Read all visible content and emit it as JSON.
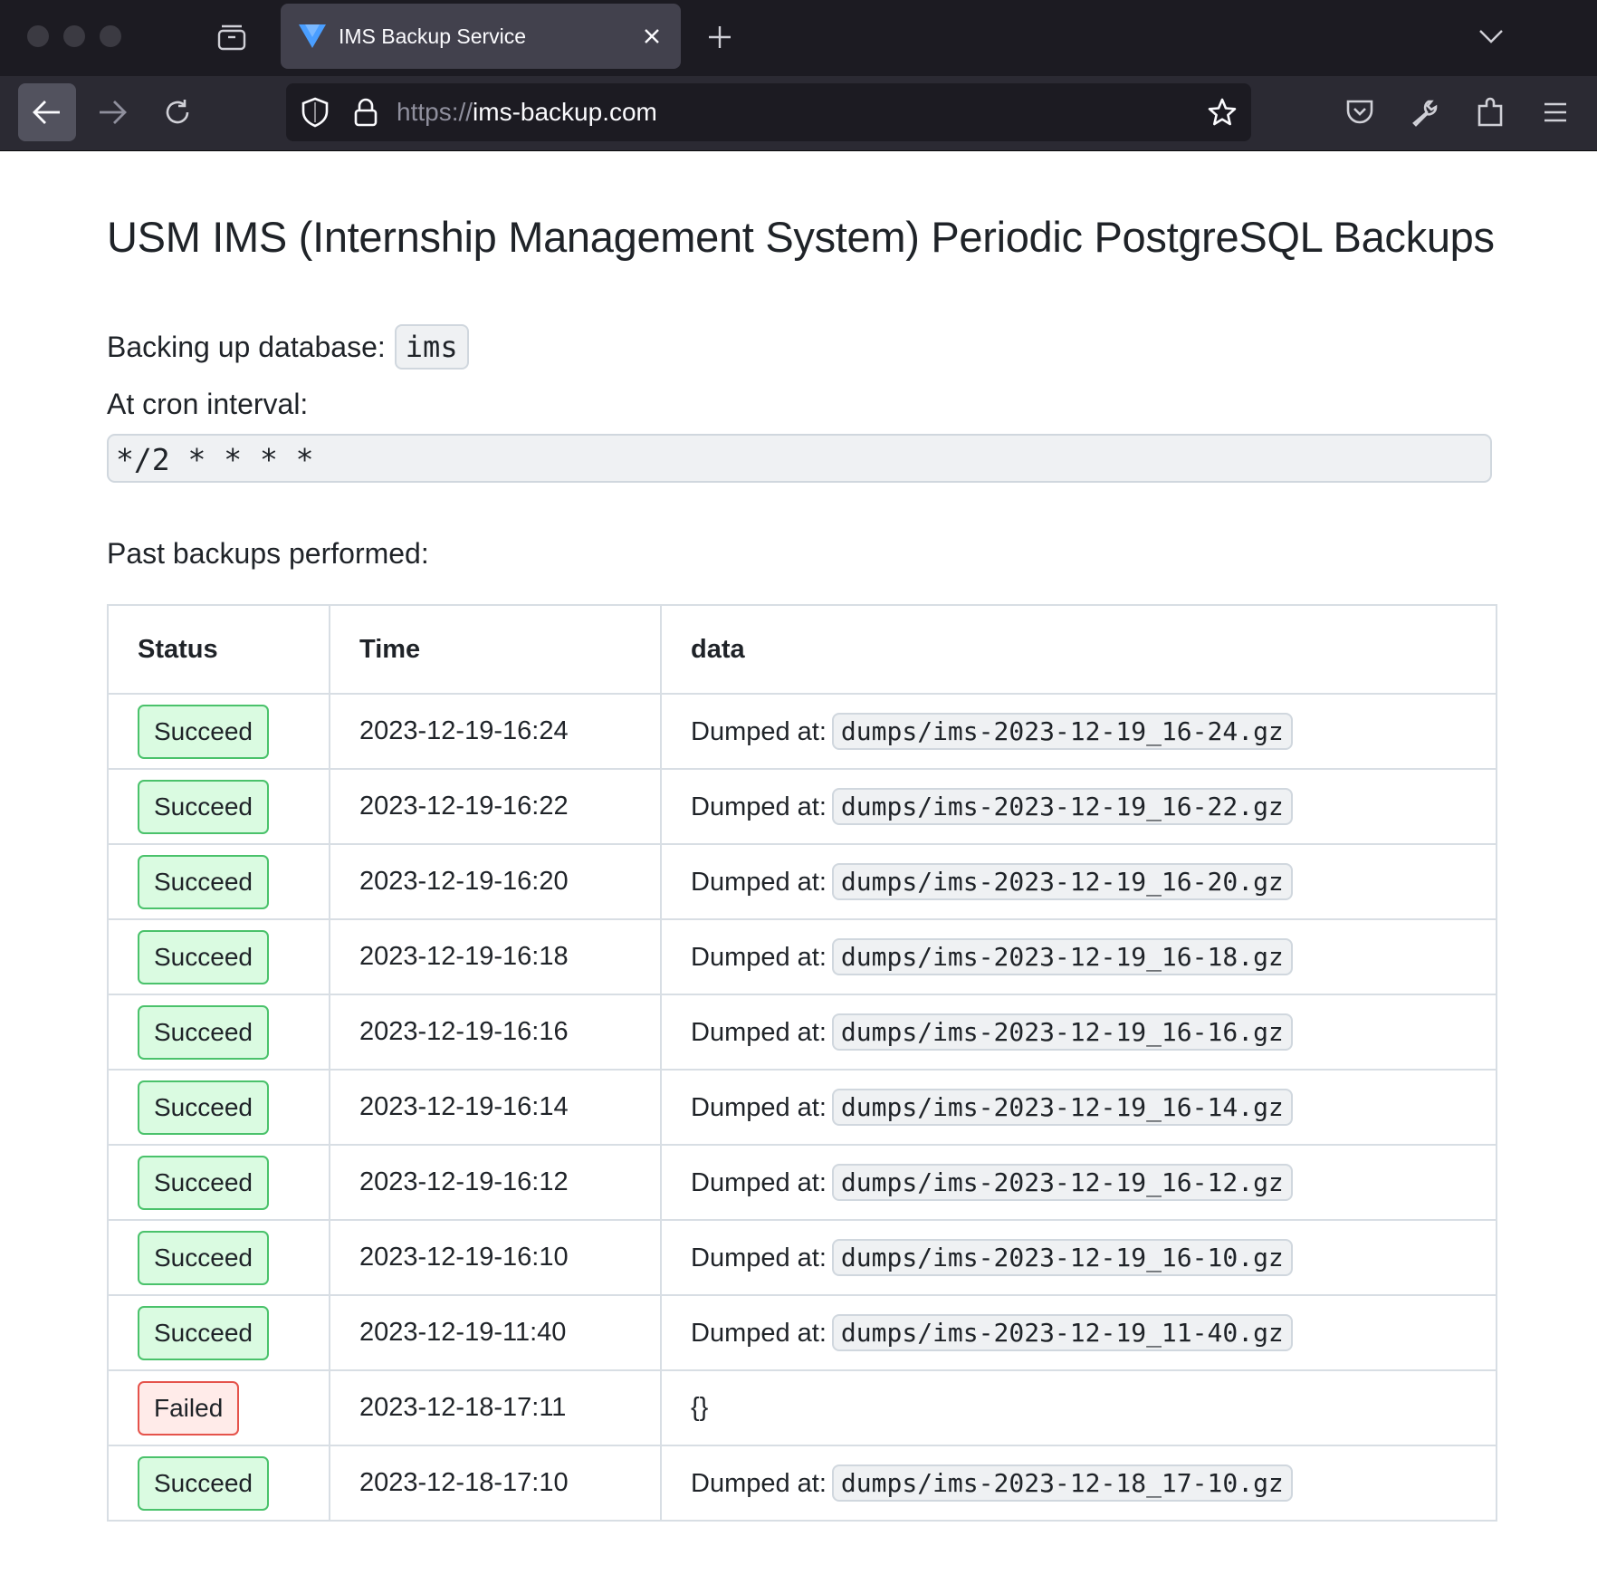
{
  "browser": {
    "tab_title": "IMS Backup Service",
    "url_scheme": "https://",
    "url_host": "ims-backup.com"
  },
  "page": {
    "title": "USM IMS (Internship Management System) Periodic PostgreSQL Backups",
    "db_label": "Backing up database:",
    "db_name": "ims",
    "cron_label": "At cron interval:",
    "cron_value": "*/2 * * * *",
    "past_label": "Past backups performed:"
  },
  "table": {
    "headers": [
      "Status",
      "Time",
      "data"
    ],
    "dump_prefix": "Dumped at:",
    "rows": [
      {
        "status": "Succeed",
        "time": "2023-12-19-16:24",
        "data": "dumps/ims-2023-12-19_16-24.gz"
      },
      {
        "status": "Succeed",
        "time": "2023-12-19-16:22",
        "data": "dumps/ims-2023-12-19_16-22.gz"
      },
      {
        "status": "Succeed",
        "time": "2023-12-19-16:20",
        "data": "dumps/ims-2023-12-19_16-20.gz"
      },
      {
        "status": "Succeed",
        "time": "2023-12-19-16:18",
        "data": "dumps/ims-2023-12-19_16-18.gz"
      },
      {
        "status": "Succeed",
        "time": "2023-12-19-16:16",
        "data": "dumps/ims-2023-12-19_16-16.gz"
      },
      {
        "status": "Succeed",
        "time": "2023-12-19-16:14",
        "data": "dumps/ims-2023-12-19_16-14.gz"
      },
      {
        "status": "Succeed",
        "time": "2023-12-19-16:12",
        "data": "dumps/ims-2023-12-19_16-12.gz"
      },
      {
        "status": "Succeed",
        "time": "2023-12-19-16:10",
        "data": "dumps/ims-2023-12-19_16-10.gz"
      },
      {
        "status": "Succeed",
        "time": "2023-12-19-11:40",
        "data": "dumps/ims-2023-12-19_11-40.gz"
      },
      {
        "status": "Failed",
        "time": "2023-12-18-17:11",
        "data": "{}"
      },
      {
        "status": "Succeed",
        "time": "2023-12-18-17:10",
        "data": "dumps/ims-2023-12-18_17-10.gz"
      }
    ]
  },
  "colors": {
    "success_bg": "#dafbe1",
    "success_border": "#4ac26b",
    "failed_bg": "#ffebe9",
    "failed_border": "#e5534b",
    "chrome_dark": "#1c1b22",
    "favicon": "#4a9eff"
  }
}
